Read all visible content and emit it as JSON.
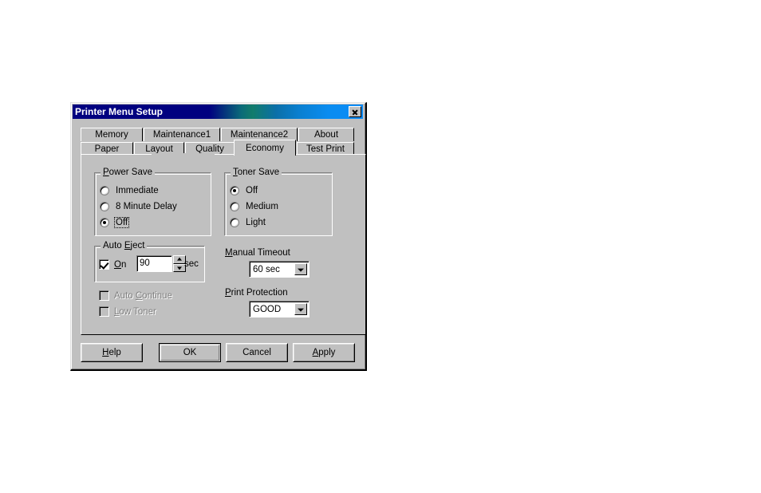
{
  "window": {
    "title": "Printer Menu Setup",
    "close_icon": "close-icon"
  },
  "tabs": {
    "row1": [
      {
        "label": "Memory",
        "selected": false
      },
      {
        "label": "Maintenance1",
        "selected": false
      },
      {
        "label": "Maintenance2",
        "selected": false
      },
      {
        "label": "About",
        "selected": false
      }
    ],
    "row2": [
      {
        "label": "Paper",
        "selected": false
      },
      {
        "label": "Layout",
        "selected": false
      },
      {
        "label": "Quality",
        "selected": false
      },
      {
        "label": "Economy",
        "selected": true
      },
      {
        "label": "Test Print",
        "selected": false
      }
    ]
  },
  "power_save": {
    "title": "Power Save",
    "accel": "P",
    "options": [
      {
        "label": "Immediate",
        "selected": false
      },
      {
        "label": "8 Minute Delay",
        "selected": false
      },
      {
        "label": "Off",
        "selected": true,
        "focused": true
      }
    ]
  },
  "toner_save": {
    "title": "Toner Save",
    "accel": "T",
    "options": [
      {
        "label": "Off",
        "selected": true
      },
      {
        "label": "Medium",
        "selected": false
      },
      {
        "label": "Light",
        "selected": false
      }
    ]
  },
  "auto_eject": {
    "title": "Auto Eject",
    "accel": "E",
    "on_label_pre": "O",
    "on_label_post": "n",
    "on_label": "On",
    "checked": true,
    "value": "90",
    "units": "sec",
    "spin_up_icon": "spinner-up-arrow-icon",
    "spin_down_icon": "spinner-down-arrow-icon"
  },
  "auto_continue": {
    "label_pre": "Auto ",
    "label_accel": "C",
    "label_post": "ontinue",
    "label": "Auto Continue",
    "checked": false,
    "enabled": false
  },
  "low_toner": {
    "label_accel": "L",
    "label_post": "ow Toner",
    "label": "Low Toner",
    "checked": false,
    "enabled": false
  },
  "manual_timeout": {
    "label_accel": "M",
    "label_post": "anual Timeout",
    "label": "Manual Timeout",
    "value": "60 sec",
    "dropdown_icon": "chevron-down-icon"
  },
  "print_protection": {
    "label_accel": "P",
    "label_post": "rint Protection",
    "label": "Print Protection",
    "value": "GOOD",
    "dropdown_icon": "chevron-down-icon"
  },
  "buttons": {
    "help": {
      "pre": "H",
      "post": "elp",
      "label": "Help"
    },
    "ok": {
      "label": "OK",
      "default": true
    },
    "cancel": {
      "label": "Cancel"
    },
    "apply": {
      "pre": "A",
      "post": "pply",
      "label": "Apply"
    }
  },
  "colors": {
    "face": "#c0c0c0",
    "title_start": "#000080",
    "title_end": "#0a8cf8",
    "shadow": "#808080",
    "highlight": "#ffffff",
    "text": "#000000",
    "disabled_text": "#808080"
  }
}
